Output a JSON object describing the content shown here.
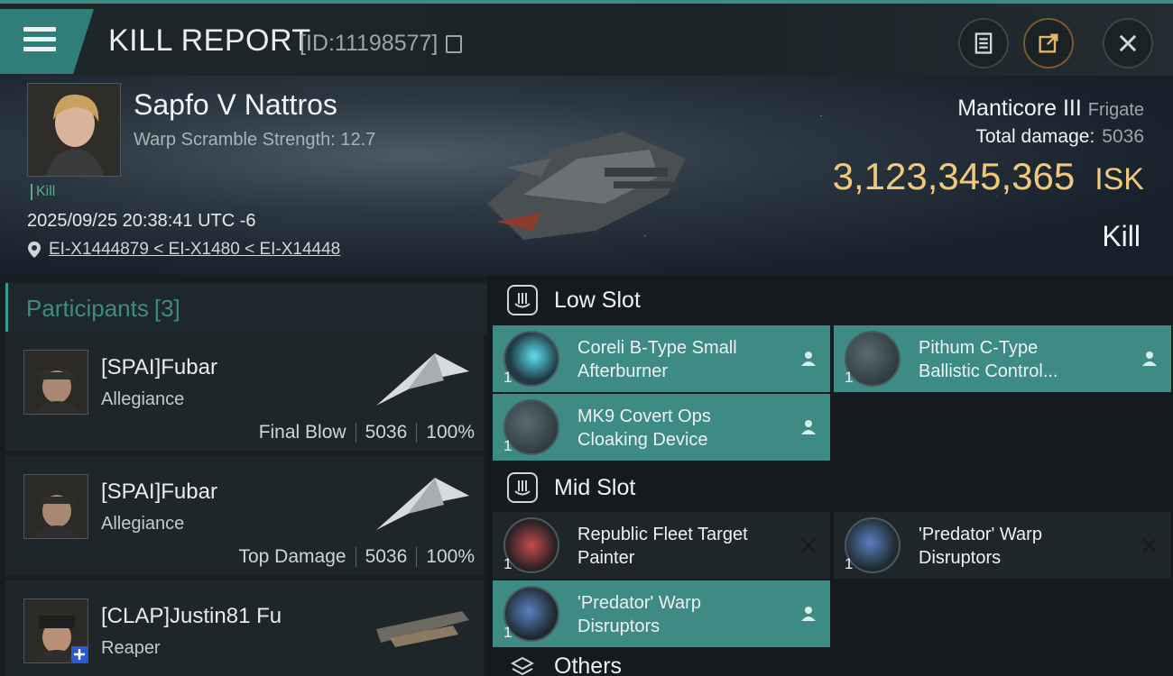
{
  "header": {
    "title": "KILL REPORT",
    "report_id": "[ID:11198577]",
    "icons": [
      "menu-icon",
      "copy-icon",
      "document-icon",
      "share-icon",
      "close-icon"
    ]
  },
  "victim": {
    "name": "Sapfo V Nattros",
    "scramble": "Warp Scramble Strength: 12.7",
    "tag": "Kill",
    "datetime": "2025/09/25 20:38:41 UTC -6",
    "location": "EI-X1444879 < EI-X1480 < EI-X14448",
    "ship_name": "Manticore III",
    "ship_class": "Frigate",
    "total_damage_label": "Total damage:",
    "total_damage": "5036",
    "isk_value": "3,123,345,365",
    "isk_unit": "ISK",
    "result": "Kill"
  },
  "participants": {
    "title": "Participants",
    "count": "[3]",
    "rows": [
      {
        "name": "[SPAI]Fubar",
        "ship": "Allegiance",
        "role": "Final Blow",
        "damage": "5036",
        "percent": "100%"
      },
      {
        "name": "[SPAI]Fubar",
        "ship": "Allegiance",
        "role": "Top Damage",
        "damage": "5036",
        "percent": "100%"
      },
      {
        "name": "[CLAP]Justin81 Fu",
        "ship": "Reaper"
      }
    ]
  },
  "fitting": {
    "low_slot": {
      "title": "Low Slot",
      "modules": [
        {
          "line1": "Coreli B-Type Small",
          "line2": "Afterburner",
          "qty": "1",
          "state": "dropped"
        },
        {
          "line1": "Pithum C-Type",
          "line2": "Ballistic Control...",
          "qty": "1",
          "state": "dropped"
        },
        {
          "line1": "MK9 Covert Ops",
          "line2": "Cloaking Device",
          "qty": "1",
          "state": "dropped"
        }
      ]
    },
    "mid_slot": {
      "title": "Mid Slot",
      "modules": [
        {
          "line1": "Republic Fleet Target",
          "line2": "Painter",
          "qty": "1",
          "state": "destroyed"
        },
        {
          "line1": "'Predator' Warp",
          "line2": "Disruptors",
          "qty": "1",
          "state": "destroyed"
        },
        {
          "line1": "'Predator' Warp",
          "line2": "Disruptors",
          "qty": "1",
          "state": "dropped"
        }
      ]
    },
    "others": {
      "title": "Others"
    }
  },
  "colors": {
    "accent": "#3e8a84",
    "isk": "#f0c97a",
    "panel": "#1e262a"
  }
}
